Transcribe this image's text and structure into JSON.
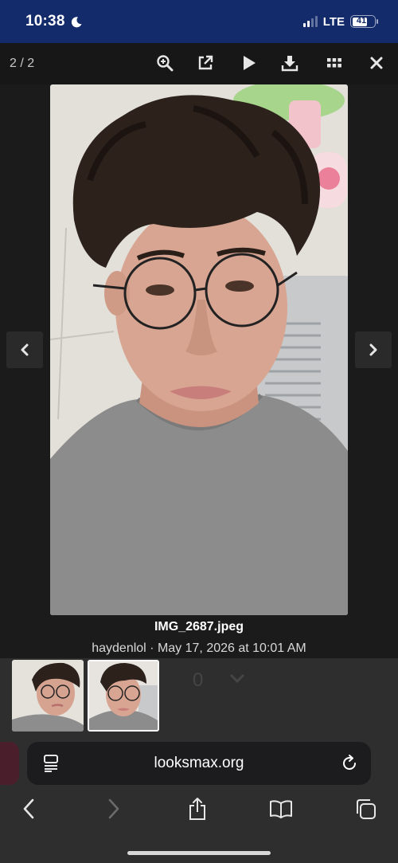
{
  "status_bar": {
    "time": "10:38",
    "network": "LTE",
    "battery": "41",
    "background_color": "#132a6b"
  },
  "lightbox": {
    "counter": "2 / 2",
    "toolbar_icons": [
      "zoom-in-icon",
      "open-external-icon",
      "play-icon",
      "download-icon",
      "grid-icon",
      "close-icon"
    ],
    "caption_title": "IMG_2687.jpeg",
    "caption_meta": "haydenlol · May 17, 2026 at 10:01 AM"
  },
  "thumbnails": [
    {
      "label": "thumb-1",
      "active": false
    },
    {
      "label": "thumb-2",
      "active": true
    }
  ],
  "background_page": {
    "reaction_count": "0"
  },
  "browser": {
    "url": "looksmax.org",
    "nav_icons": [
      "back-icon",
      "forward-icon",
      "share-icon",
      "bookmarks-icon",
      "tabs-icon"
    ]
  }
}
